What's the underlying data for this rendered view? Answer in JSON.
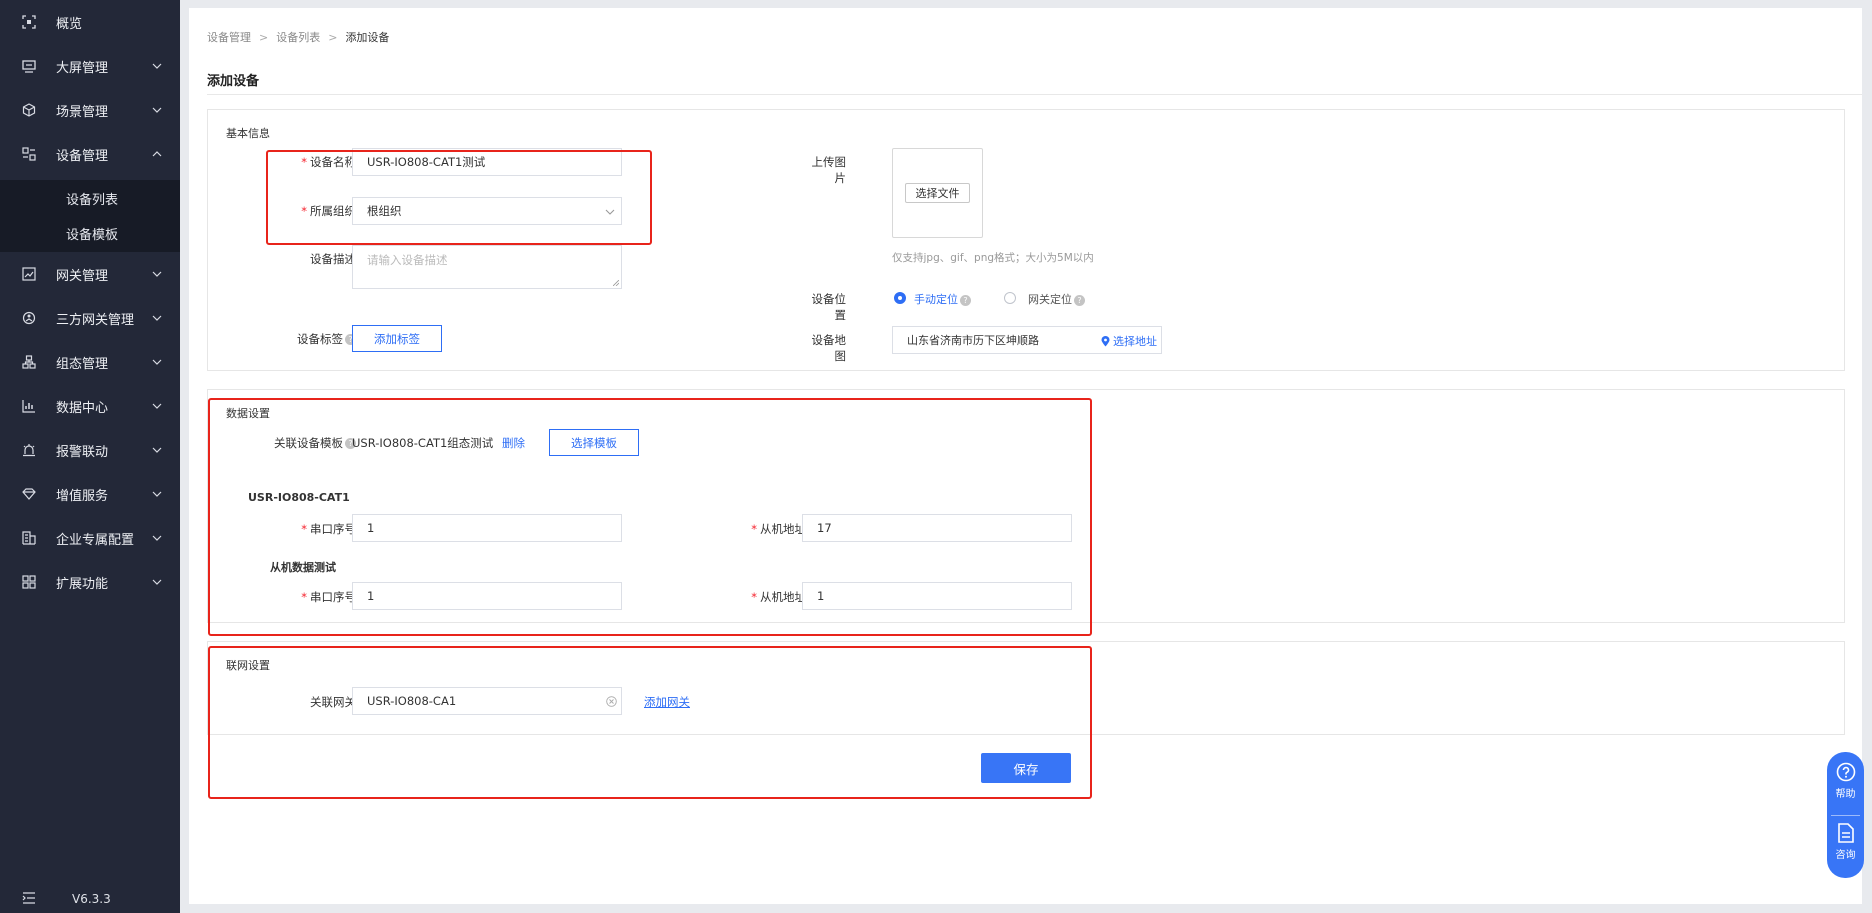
{
  "sidebar": {
    "items": [
      {
        "label": "概览",
        "icon": "overview-icon",
        "chevron": ""
      },
      {
        "label": "大屏管理",
        "icon": "screen-icon",
        "chevron": "down"
      },
      {
        "label": "场景管理",
        "icon": "cube-icon",
        "chevron": "down"
      },
      {
        "label": "设备管理",
        "icon": "device-icon",
        "chevron": "up"
      },
      {
        "label": "网关管理",
        "icon": "gateway-icon",
        "chevron": "down"
      },
      {
        "label": "三方网关管理",
        "icon": "third-party-gateway-icon",
        "chevron": "down"
      },
      {
        "label": "组态管理",
        "icon": "configuration-icon",
        "chevron": "down"
      },
      {
        "label": "数据中心",
        "icon": "data-center-icon",
        "chevron": "down"
      },
      {
        "label": "报警联动",
        "icon": "alarm-icon",
        "chevron": "down"
      },
      {
        "label": "增值服务",
        "icon": "diamond-icon",
        "chevron": "down"
      },
      {
        "label": "企业专属配置",
        "icon": "enterprise-icon",
        "chevron": "down"
      },
      {
        "label": "扩展功能",
        "icon": "grid-icon",
        "chevron": "down"
      }
    ],
    "sub_items": [
      "设备列表",
      "设备模板"
    ],
    "version": "V6.3.3"
  },
  "breadcrumb": [
    "设备管理",
    "设备列表",
    "添加设备"
  ],
  "page_title": "添加设备",
  "basic": {
    "title": "基本信息",
    "name_label": "设备名称",
    "name_value": "USR-IO808-CAT1测试",
    "org_label": "所属组织",
    "org_value": "根组织",
    "desc_label": "设备描述",
    "desc_placeholder": "请输入设备描述",
    "tag_label": "设备标签",
    "tag_button": "添加标签",
    "upload_label": "上传图片",
    "upload_button": "选择文件",
    "upload_hint": "仅支持jpg、gif、png格式；大小为5M以内",
    "position_label": "设备位置",
    "position_manual": "手动定位",
    "position_gateway": "网关定位",
    "map_label": "设备地图",
    "map_value": "山东省济南市历下区坤顺路",
    "map_button": "选择地址"
  },
  "data_settings": {
    "title": "数据设置",
    "template_label": "关联设备模板",
    "template_value": "USR-IO808-CAT1组态测试",
    "delete_link": "删除",
    "select_template_button": "选择模板",
    "groups": [
      {
        "name": "USR-IO808-CAT1",
        "serial_label": "串口序号",
        "serial_value": "1",
        "slave_label": "从机地址",
        "slave_value": "17"
      },
      {
        "name": "从机数据测试",
        "serial_label": "串口序号",
        "serial_value": "1",
        "slave_label": "从机地址",
        "slave_value": "1"
      }
    ]
  },
  "network": {
    "title": "联网设置",
    "gateway_label": "关联网关",
    "gateway_value": "USR-IO808-CA1",
    "add_gateway_link": "添加网关",
    "save_button": "保存"
  },
  "float_bar": {
    "help": "帮助",
    "consult": "咨询"
  },
  "colors": {
    "sidebar_bg": "#232838",
    "accent": "#3875f6",
    "highlight_box": "#e8241b",
    "required": "#f5222d"
  }
}
